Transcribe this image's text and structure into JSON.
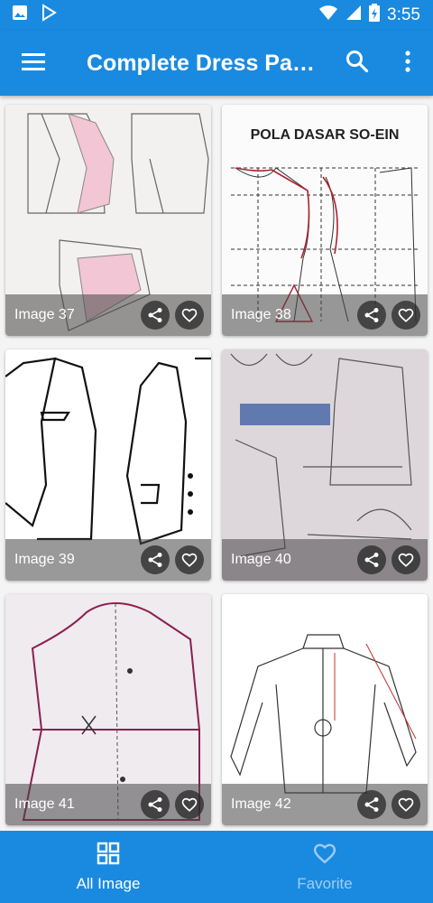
{
  "status_bar": {
    "time": "3:55"
  },
  "app_bar": {
    "title": "Complete Dress Patterns"
  },
  "grid": {
    "items": [
      {
        "label": "Image 37"
      },
      {
        "label": "Image 38",
        "caption": "POLA DASAR SO-EIN"
      },
      {
        "label": "Image 39"
      },
      {
        "label": "Image 40"
      },
      {
        "label": "Image 41"
      },
      {
        "label": "Image 42"
      }
    ]
  },
  "bottom_nav": {
    "items": [
      {
        "label": "All Image",
        "icon": "grid-icon",
        "active": true
      },
      {
        "label": "Favorite",
        "icon": "heart-icon",
        "active": false
      }
    ]
  },
  "colors": {
    "primary": "#1a8ae0",
    "inactive_nav": "#9fcdf2"
  }
}
